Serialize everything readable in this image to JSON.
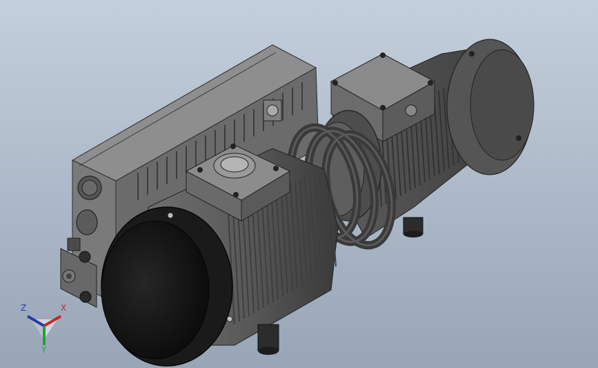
{
  "viewport": {
    "background_top": "#c4cfdc",
    "background_bottom": "#97a5b6",
    "model": "vacuum-pump-assembly"
  },
  "triad": {
    "x_label": "X",
    "y_label": "Y",
    "z_label": "Z",
    "x_color": "#c0282d",
    "y_color": "#23a03a",
    "z_color": "#2a3aa8"
  }
}
